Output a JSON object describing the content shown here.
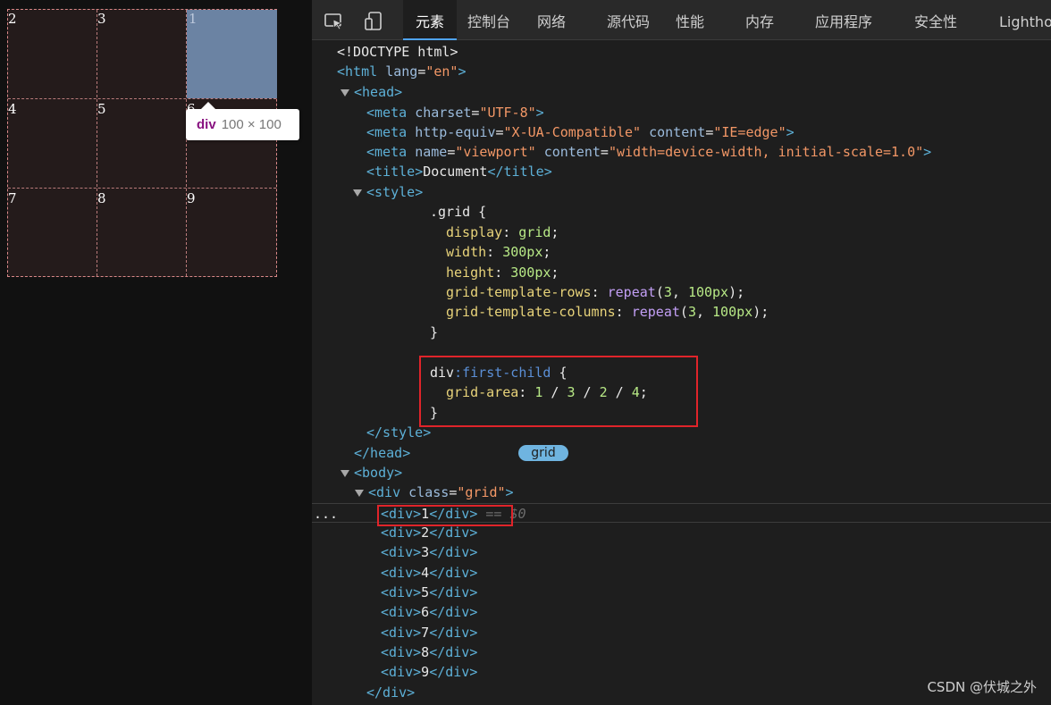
{
  "viewport": {
    "cells": [
      "1",
      "2",
      "3",
      "4",
      "5",
      "6",
      "7",
      "8",
      "9"
    ],
    "tooltip": {
      "tag": "div",
      "size": "100 × 100"
    }
  },
  "devtools": {
    "tabs": [
      "元素",
      "控制台",
      "网络",
      "源代码",
      "性能",
      "内存",
      "应用程序",
      "安全性",
      "Lighthouse"
    ],
    "active_tab": "元素",
    "grid_badge": "grid",
    "selected_marker": "== $0",
    "lines": [
      "<!DOCTYPE html>",
      "<html lang=\"en\">",
      "<head>",
      "<meta charset=\"UTF-8\">",
      "<meta http-equiv=\"X-UA-Compatible\" content=\"IE=edge\">",
      "<meta name=\"viewport\" content=\"width=device-width, initial-scale=1.0\">",
      "<title>Document</title>",
      "<style>",
      ".grid {",
      "display: grid;",
      "width: 300px;",
      "height: 300px;",
      "grid-template-rows: repeat(3, 100px);",
      "grid-template-columns: repeat(3, 100px);",
      "}",
      "div:first-child {",
      "grid-area: 1 / 3 / 2 / 4;",
      "}",
      "</style>",
      "</head>",
      "<body>",
      "<div class=\"grid\">",
      "<div>1</div>",
      "<div>2</div>",
      "<div>3</div>",
      "<div>4</div>",
      "<div>5</div>",
      "<div>6</div>",
      "<div>7</div>",
      "<div>8</div>",
      "<div>9</div>",
      "</div>"
    ]
  },
  "watermark": "CSDN @伏城之外"
}
